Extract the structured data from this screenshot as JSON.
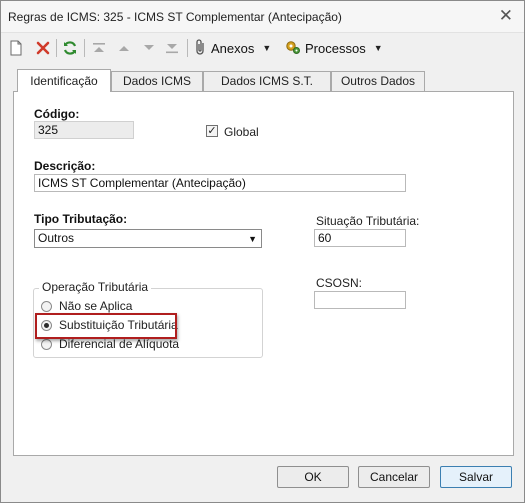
{
  "window": {
    "title": "Regras de ICMS: 325 - ICMS ST Complementar (Antecipação)"
  },
  "toolbar": {
    "icons": [
      "new-doc-icon",
      "delete-icon",
      "refresh-icon",
      "move-first-icon",
      "move-up-icon",
      "move-down-icon",
      "move-last-icon",
      "attachment-icon",
      "process-icon"
    ],
    "anexos_label": "Anexos",
    "processos_label": "Processos"
  },
  "tabs": [
    "Identificação",
    "Dados ICMS",
    "Dados ICMS S.T.",
    "Outros Dados"
  ],
  "active_tab": "Identificação",
  "form": {
    "codigo_label": "Código:",
    "codigo_value": "325",
    "global_label": "Global",
    "global_checked": true,
    "descricao_label": "Descrição:",
    "descricao_value": "ICMS ST Complementar (Antecipação)",
    "tipo_label": "Tipo Tributação:",
    "tipo_value": "Outros",
    "situacao_label": "Situação Tributária:",
    "situacao_value": "60",
    "csosn_label": "CSOSN:",
    "csosn_value": "",
    "operacao_label": "Operação Tributária",
    "operacao_options": [
      "Não se Aplica",
      "Substituição Tributária",
      "Diferencial de Alíquota"
    ],
    "operacao_selected": "Substituição Tributária"
  },
  "buttons": {
    "ok": "OK",
    "cancel": "Cancelar",
    "save": "Salvar"
  },
  "colors": {
    "highlight": "#b01e1e",
    "refresh": "#2f8a2f",
    "delete": "#d03a2a"
  }
}
